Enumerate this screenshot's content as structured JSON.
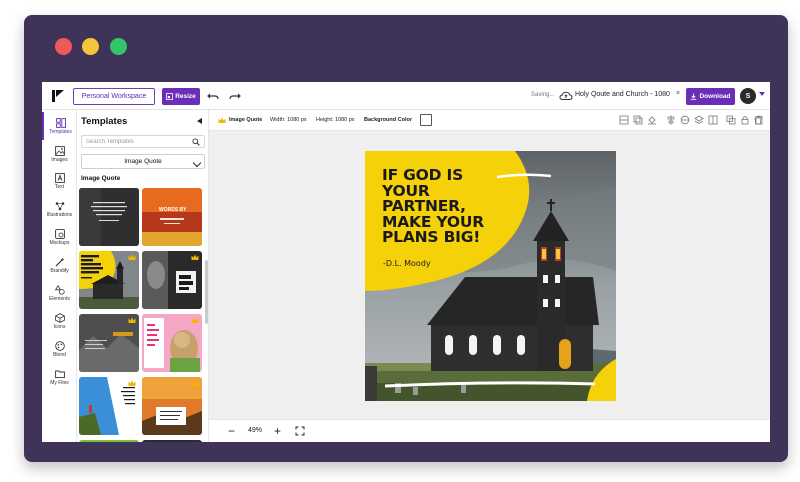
{
  "window": {
    "controls": [
      "close",
      "minimize",
      "maximize"
    ],
    "colors": {
      "frame": "#3f3358",
      "close": "#ee5a5a",
      "minimize": "#f4c63a",
      "maximize": "#34c46a"
    }
  },
  "topbar": {
    "logo_icon": "logo-icon",
    "workspace_label": "Personal Workspace",
    "resize_label": "Resize",
    "save_status": "Saving...",
    "doc_title": "Holy Qoute and Church - 1080",
    "download_label": "Download",
    "avatar_initial": "S",
    "accent_color": "#6b2fb7"
  },
  "sidebar": {
    "items": [
      {
        "label": "Templates",
        "icon": "templates-icon",
        "active": true
      },
      {
        "label": "Images",
        "icon": "images-icon"
      },
      {
        "label": "Text",
        "icon": "text-icon"
      },
      {
        "label": "Illustrations",
        "icon": "illustrations-icon"
      },
      {
        "label": "Mockups",
        "icon": "mockups-icon"
      },
      {
        "label": "Brandify",
        "icon": "brandify-icon"
      },
      {
        "label": "Elements",
        "icon": "elements-icon"
      },
      {
        "label": "Icons",
        "icon": "icons-icon"
      },
      {
        "label": "Blend",
        "icon": "blend-icon"
      },
      {
        "label": "My Files",
        "icon": "my-files-icon"
      }
    ]
  },
  "panel": {
    "title": "Templates",
    "search_placeholder": "Search Templates",
    "category_selected": "Image Quote",
    "section_label": "Image Quote",
    "thumbnails": [
      {
        "name": "dark-quote-template",
        "premium": false,
        "text": ""
      },
      {
        "name": "orange-words-template",
        "premium": false,
        "text": "WORDS BY"
      },
      {
        "name": "church-quote-template",
        "premium": true,
        "text": "IF GOD IS YOUR PARTNER, MAKE YOUR PLANS BIG!"
      },
      {
        "name": "eat-sleep-template",
        "premium": true,
        "text": "EAT SLEEP REPEAT"
      },
      {
        "name": "landscape-quote-template",
        "premium": true,
        "text": ""
      },
      {
        "name": "dog-love-template",
        "premium": true,
        "text": "All you need is love and a dog"
      },
      {
        "name": "cliff-quote-template",
        "premium": true,
        "text": "LIFE HAS NO LIMITATIONS EXCEPT THE ONES YOU MAKE"
      },
      {
        "name": "sunset-quote-template",
        "premium": true,
        "text": ""
      },
      {
        "name": "green-template",
        "premium": false,
        "text": ""
      },
      {
        "name": "dark-template",
        "premium": true,
        "text": ""
      }
    ]
  },
  "toolbar": {
    "template_type": "Image Quote",
    "width_label": "Width: 1080 px",
    "height_label": "Height: 1080 px",
    "background_label": "Background Color",
    "background_color": "#ffffff",
    "tool_icons": [
      "layout-icon",
      "duplicate-icon",
      "fill-icon",
      "align-icon",
      "distribute-icon",
      "layers-icon",
      "flip-icon",
      "copy-icon",
      "lock-icon",
      "paste-icon",
      "delete-icon"
    ]
  },
  "canvas": {
    "quote_lines": [
      "IF GOD IS",
      "YOUR",
      "PARTNER,",
      "MAKE YOUR",
      "PLANS BIG!"
    ],
    "author": "-D.L. Moody",
    "accent_yellow": "#f5d10a"
  },
  "zoombar": {
    "minus_label": "−",
    "zoom_value": "49%",
    "plus_label": "+",
    "fit_icon": "fit-screen-icon"
  }
}
